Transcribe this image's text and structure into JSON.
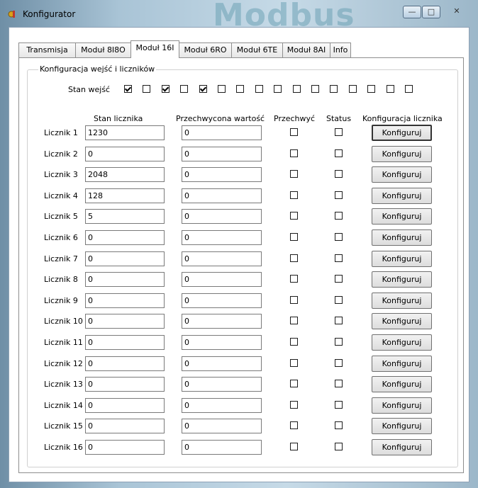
{
  "window": {
    "title": "Konfigurator",
    "background_word": "Modbus",
    "controls": {
      "minimize": "—",
      "maximize": "□",
      "close": "✕"
    }
  },
  "tabs": [
    {
      "label": "Transmisja",
      "active": false
    },
    {
      "label": "Moduł 8I8O",
      "active": false
    },
    {
      "label": "Moduł 16I",
      "active": true
    },
    {
      "label": "Moduł 6RO",
      "active": false
    },
    {
      "label": "Moduł 6TE",
      "active": false
    },
    {
      "label": "Moduł 8AI",
      "active": false
    },
    {
      "label": "Info",
      "active": false
    }
  ],
  "group": {
    "title": "Konfiguracja wejść i liczników",
    "inputs_label": "Stan wejść",
    "inputs_state": [
      true,
      false,
      true,
      false,
      true,
      false,
      false,
      false,
      false,
      false,
      false,
      false,
      false,
      false,
      false,
      false
    ]
  },
  "table": {
    "headers": {
      "counter": "Stan licznika",
      "captured": "Przechwycona wartość",
      "capture": "Przechwyć",
      "status": "Status",
      "config": "Konfiguracja licznika"
    },
    "rows": [
      {
        "label": "Licznik 1",
        "counter": "1230",
        "captured": "0",
        "capture": false,
        "status": false,
        "button": "Konfiguruj"
      },
      {
        "label": "Licznik 2",
        "counter": "0",
        "captured": "0",
        "capture": false,
        "status": false,
        "button": "Konfiguruj"
      },
      {
        "label": "Licznik 3",
        "counter": "2048",
        "captured": "0",
        "capture": false,
        "status": false,
        "button": "Konfiguruj"
      },
      {
        "label": "Licznik 4",
        "counter": "128",
        "captured": "0",
        "capture": false,
        "status": false,
        "button": "Konfiguruj"
      },
      {
        "label": "Licznik 5",
        "counter": "5",
        "captured": "0",
        "capture": false,
        "status": false,
        "button": "Konfiguruj"
      },
      {
        "label": "Licznik 6",
        "counter": "0",
        "captured": "0",
        "capture": false,
        "status": false,
        "button": "Konfiguruj"
      },
      {
        "label": "Licznik 7",
        "counter": "0",
        "captured": "0",
        "capture": false,
        "status": false,
        "button": "Konfiguruj"
      },
      {
        "label": "Licznik 8",
        "counter": "0",
        "captured": "0",
        "capture": false,
        "status": false,
        "button": "Konfiguruj"
      },
      {
        "label": "Licznik 9",
        "counter": "0",
        "captured": "0",
        "capture": false,
        "status": false,
        "button": "Konfiguruj"
      },
      {
        "label": "Licznik 10",
        "counter": "0",
        "captured": "0",
        "capture": false,
        "status": false,
        "button": "Konfiguruj"
      },
      {
        "label": "Licznik 11",
        "counter": "0",
        "captured": "0",
        "capture": false,
        "status": false,
        "button": "Konfiguruj"
      },
      {
        "label": "Licznik 12",
        "counter": "0",
        "captured": "0",
        "capture": false,
        "status": false,
        "button": "Konfiguruj"
      },
      {
        "label": "Licznik 13",
        "counter": "0",
        "captured": "0",
        "capture": false,
        "status": false,
        "button": "Konfiguruj"
      },
      {
        "label": "Licznik 14",
        "counter": "0",
        "captured": "0",
        "capture": false,
        "status": false,
        "button": "Konfiguruj"
      },
      {
        "label": "Licznik 15",
        "counter": "0",
        "captured": "0",
        "capture": false,
        "status": false,
        "button": "Konfiguruj"
      },
      {
        "label": "Licznik 16",
        "counter": "0",
        "captured": "0",
        "capture": false,
        "status": false,
        "button": "Konfiguruj"
      }
    ]
  }
}
